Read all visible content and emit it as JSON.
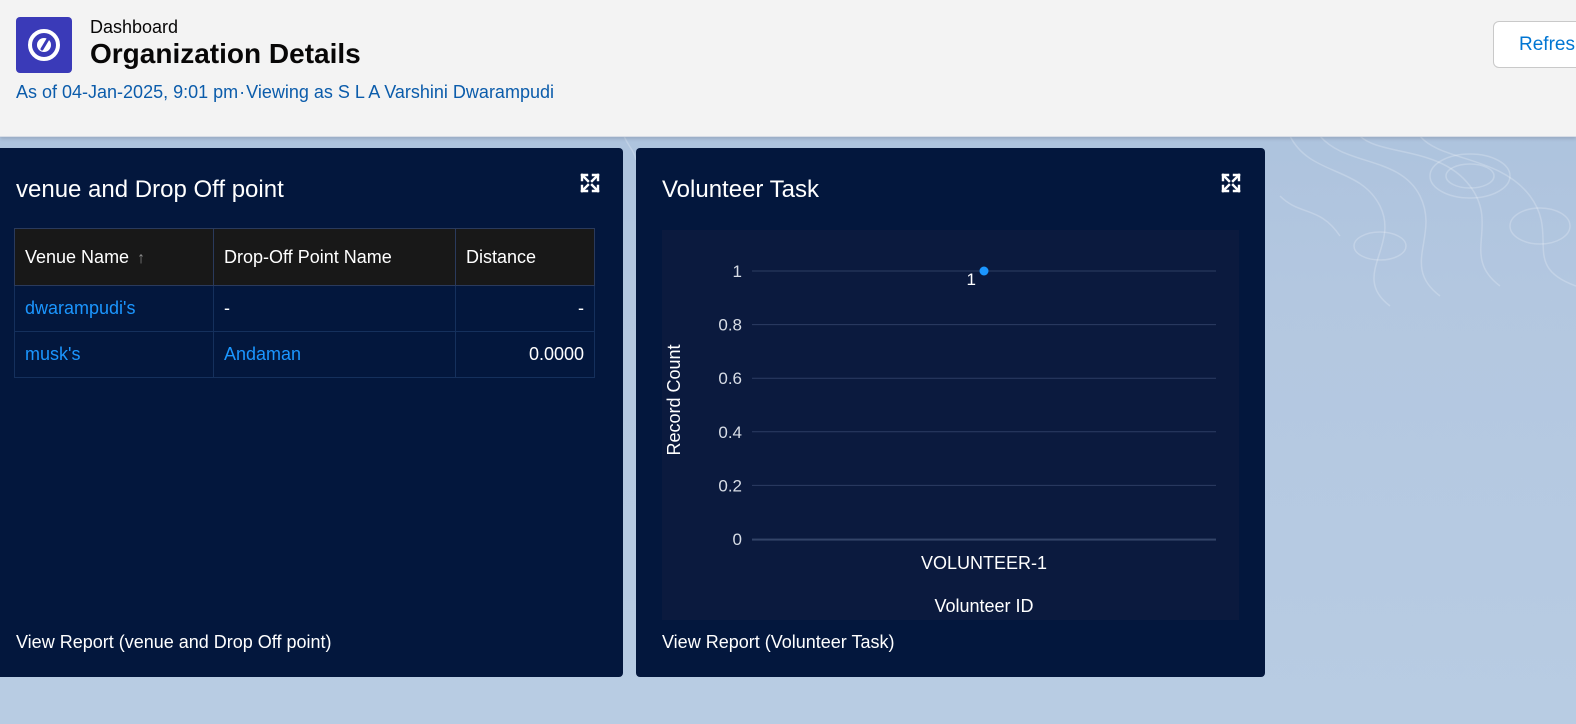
{
  "header": {
    "eyebrow": "Dashboard",
    "title": "Organization Details",
    "as_of": "As of 04-Jan-2025, 9:01 pm",
    "separator": "·",
    "viewing_as": "Viewing as S L A Varshini Dwarampudi",
    "refresh_label": "Refresh",
    "app_icon": "dashboard-gauge-icon"
  },
  "cards": {
    "venue": {
      "title": "venue and Drop Off point",
      "columns": [
        "Venue Name",
        "Drop-Off Point Name",
        "Distance"
      ],
      "sort_icon": "arrow-up-icon",
      "rows": [
        {
          "venue": "dwarampudi's",
          "dropoff": "-",
          "distance": "-"
        },
        {
          "venue": "musk's",
          "dropoff": "Andaman",
          "distance": "0.0000"
        }
      ],
      "footer": "View Report (venue and Drop Off point)",
      "expand_icon": "expand-icon"
    },
    "volunteer": {
      "title": "Volunteer Task",
      "footer": "View Report (Volunteer Task)",
      "expand_icon": "expand-icon"
    }
  },
  "chart_data": {
    "type": "scatter",
    "categories": [
      "VOLUNTEER-1"
    ],
    "values": [
      1
    ],
    "data_labels": [
      "1"
    ],
    "xlabel": "Volunteer ID",
    "ylabel": "Record Count",
    "ylim": [
      0,
      1
    ],
    "yticks": [
      "0",
      "0.2",
      "0.4",
      "0.6",
      "0.8",
      "1"
    ],
    "grid": true,
    "point_color": "#1b96ff"
  },
  "colors": {
    "card_bg": "#03173d",
    "link": "#1b96ff",
    "header_sub": "#0b5cab"
  }
}
